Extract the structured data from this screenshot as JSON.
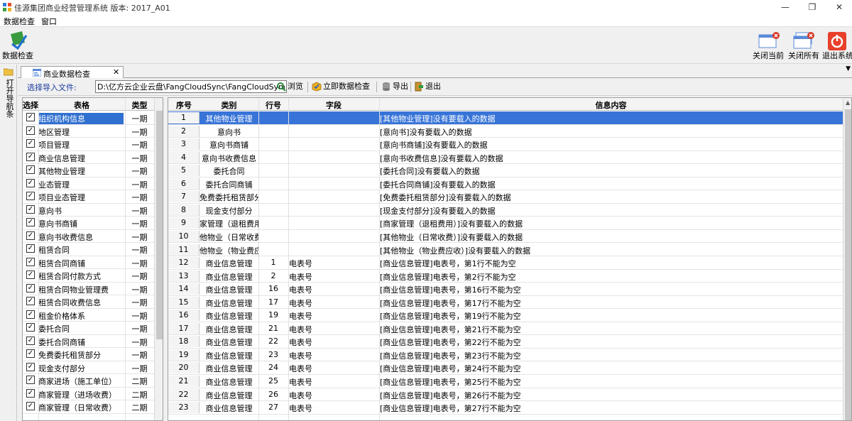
{
  "window": {
    "title": "佳源集团商业经营管理系统  版本: 2017_A01",
    "controls": {
      "minimize": "—",
      "maximize": "❐",
      "close": "✕"
    }
  },
  "menubar": {
    "items": [
      "数据检查",
      "窗口"
    ]
  },
  "toolbar": {
    "data_check": "数据检查",
    "close_current": "关闭当前",
    "close_all": "关闭所有",
    "exit_system": "退出系统"
  },
  "left_strip": {
    "label": "打开导航条"
  },
  "tab": {
    "label": "商业数据检查",
    "close": "✕",
    "dropdown": "▼"
  },
  "subtoolbar": {
    "label": "选择导入文件:",
    "file_path": "D:\\亿方云企业云盘\\FangCloudSync\\FangCloudSync\\东",
    "browse": "浏览",
    "check_now": "立即数据检查",
    "export": "导出",
    "exit": "退出"
  },
  "left_table": {
    "headers": [
      "选择",
      "表格",
      "类型"
    ],
    "rows": [
      {
        "name": "组织机构信息",
        "type": "一期",
        "checked": true
      },
      {
        "name": "地区管理",
        "type": "一期",
        "checked": true
      },
      {
        "name": "项目管理",
        "type": "一期",
        "checked": true
      },
      {
        "name": "商业信息管理",
        "type": "一期",
        "checked": true
      },
      {
        "name": "其他物业管理",
        "type": "一期",
        "checked": true
      },
      {
        "name": "业态管理",
        "type": "一期",
        "checked": true
      },
      {
        "name": "项目业态管理",
        "type": "一期",
        "checked": true
      },
      {
        "name": "意向书",
        "type": "一期",
        "checked": true
      },
      {
        "name": "意向书商铺",
        "type": "一期",
        "checked": true
      },
      {
        "name": "意向书收费信息",
        "type": "一期",
        "checked": true
      },
      {
        "name": "租赁合同",
        "type": "一期",
        "checked": true
      },
      {
        "name": "租赁合同商铺",
        "type": "一期",
        "checked": true
      },
      {
        "name": "租赁合同付款方式",
        "type": "一期",
        "checked": true
      },
      {
        "name": "租赁合同物业管理费",
        "type": "一期",
        "checked": true
      },
      {
        "name": "租赁合同收费信息",
        "type": "一期",
        "checked": true
      },
      {
        "name": "租金价格体系",
        "type": "一期",
        "checked": true
      },
      {
        "name": "委托合同",
        "type": "一期",
        "checked": true
      },
      {
        "name": "委托合同商铺",
        "type": "一期",
        "checked": true
      },
      {
        "name": "免费委托租赁部分",
        "type": "一期",
        "checked": true
      },
      {
        "name": "现金支付部分",
        "type": "一期",
        "checked": true
      },
      {
        "name": "商家进场（施工单位）",
        "type": "二期",
        "checked": true
      },
      {
        "name": "商家管理（进场收费）",
        "type": "二期",
        "checked": true
      },
      {
        "name": "商家管理（日常收费）",
        "type": "二期",
        "checked": true
      }
    ]
  },
  "right_table": {
    "headers": [
      "序号",
      "类别",
      "行号",
      "字段",
      "信息内容"
    ],
    "rows": [
      {
        "no": "1",
        "cat": "其他物业管理",
        "line": "",
        "field": "",
        "msg": "[其他物业管理]没有要载入的数据"
      },
      {
        "no": "2",
        "cat": "意向书",
        "line": "",
        "field": "",
        "msg": "[意向书]没有要载入的数据"
      },
      {
        "no": "3",
        "cat": "意向书商铺",
        "line": "",
        "field": "",
        "msg": "[意向书商铺]没有要载入的数据"
      },
      {
        "no": "4",
        "cat": "意向书收费信息",
        "line": "",
        "field": "",
        "msg": "[意向书收费信息]没有要载入的数据"
      },
      {
        "no": "5",
        "cat": "委托合同",
        "line": "",
        "field": "",
        "msg": "[委托合同]没有要载入的数据"
      },
      {
        "no": "6",
        "cat": "委托合同商铺",
        "line": "",
        "field": "",
        "msg": "[委托合同商铺]没有要载入的数据"
      },
      {
        "no": "7",
        "cat": "免费委托租赁部分",
        "line": "",
        "field": "",
        "msg": "[免费委托租赁部分]没有要载入的数据"
      },
      {
        "no": "8",
        "cat": "现金支付部分",
        "line": "",
        "field": "",
        "msg": "[现金支付部分]没有要载入的数据"
      },
      {
        "no": "9",
        "cat": "家管理（退租费用",
        "line": "",
        "field": "",
        "msg": "[商家管理（退租费用）]没有要载入的数据"
      },
      {
        "no": "10",
        "cat": "他物业（日常收费",
        "line": "",
        "field": "",
        "msg": "[其他物业（日常收费）]没有要载入的数据"
      },
      {
        "no": "11",
        "cat": "他物业（物业费应收",
        "line": "",
        "field": "",
        "msg": "[其他物业（物业费应收）]没有要载入的数据"
      },
      {
        "no": "12",
        "cat": "商业信息管理",
        "line": "1",
        "field": "电表号",
        "msg": "[商业信息管理]电表号，第1行不能为空"
      },
      {
        "no": "13",
        "cat": "商业信息管理",
        "line": "2",
        "field": "电表号",
        "msg": "[商业信息管理]电表号，第2行不能为空"
      },
      {
        "no": "14",
        "cat": "商业信息管理",
        "line": "16",
        "field": "电表号",
        "msg": "[商业信息管理]电表号，第16行不能为空"
      },
      {
        "no": "15",
        "cat": "商业信息管理",
        "line": "17",
        "field": "电表号",
        "msg": "[商业信息管理]电表号，第17行不能为空"
      },
      {
        "no": "16",
        "cat": "商业信息管理",
        "line": "19",
        "field": "电表号",
        "msg": "[商业信息管理]电表号，第19行不能为空"
      },
      {
        "no": "17",
        "cat": "商业信息管理",
        "line": "21",
        "field": "电表号",
        "msg": "[商业信息管理]电表号，第21行不能为空"
      },
      {
        "no": "18",
        "cat": "商业信息管理",
        "line": "22",
        "field": "电表号",
        "msg": "[商业信息管理]电表号，第22行不能为空"
      },
      {
        "no": "19",
        "cat": "商业信息管理",
        "line": "23",
        "field": "电表号",
        "msg": "[商业信息管理]电表号，第23行不能为空"
      },
      {
        "no": "20",
        "cat": "商业信息管理",
        "line": "24",
        "field": "电表号",
        "msg": "[商业信息管理]电表号，第24行不能为空"
      },
      {
        "no": "21",
        "cat": "商业信息管理",
        "line": "25",
        "field": "电表号",
        "msg": "[商业信息管理]电表号，第25行不能为空"
      },
      {
        "no": "22",
        "cat": "商业信息管理",
        "line": "26",
        "field": "电表号",
        "msg": "[商业信息管理]电表号，第26行不能为空"
      },
      {
        "no": "23",
        "cat": "商业信息管理",
        "line": "27",
        "field": "电表号",
        "msg": "[商业信息管理]电表号，第27行不能为空"
      }
    ]
  },
  "colors": {
    "selection": "#3874d8",
    "label_blue": "#1a3aa0",
    "exit_red": "#e8402a"
  },
  "icons": [
    "app-icon",
    "data-check-icon",
    "close-current-icon",
    "close-all-icon",
    "exit-system-icon",
    "folder-icon",
    "tab-icon",
    "browse-icon",
    "check-now-icon",
    "export-icon",
    "exit-icon",
    "checkbox-icon"
  ]
}
